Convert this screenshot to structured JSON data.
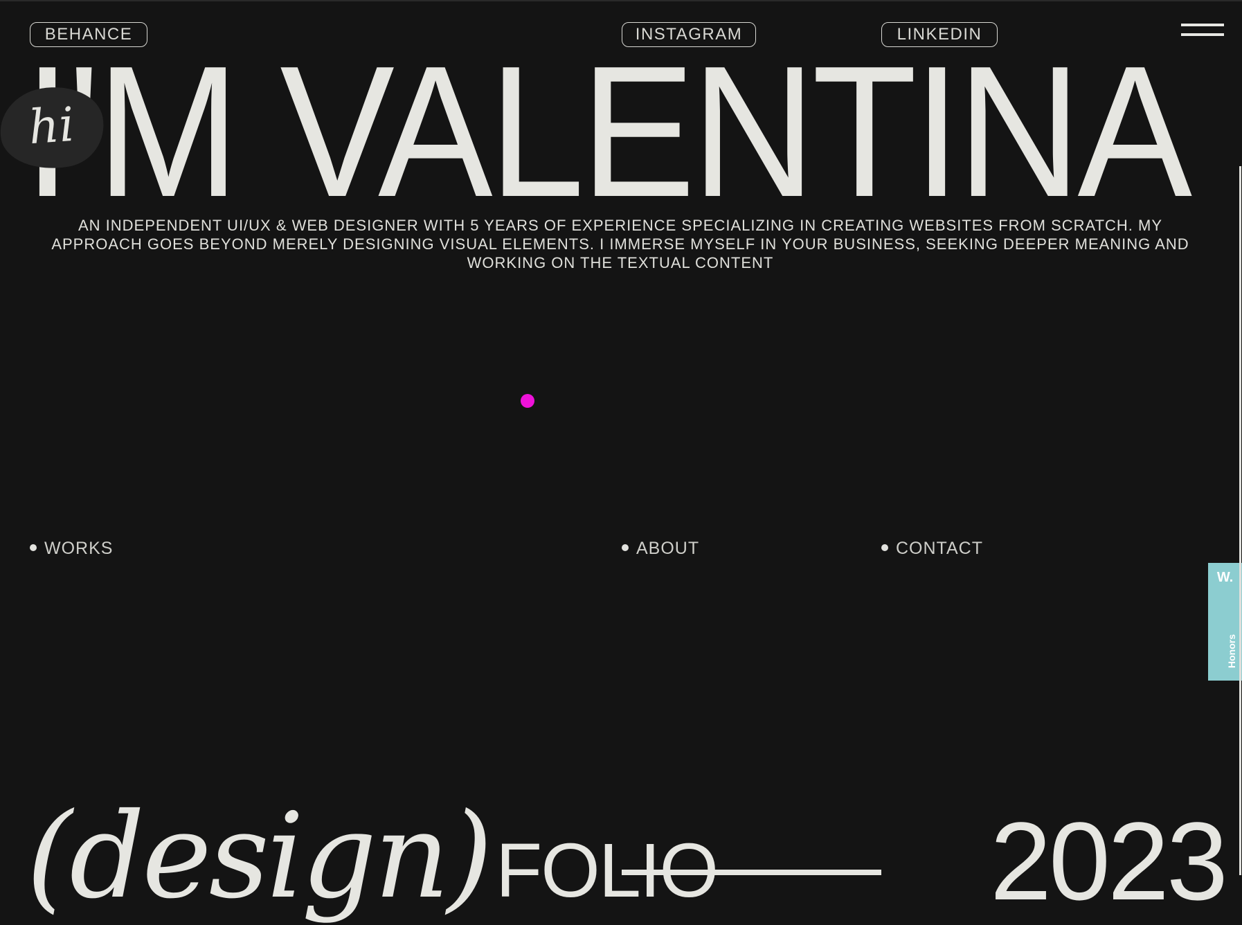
{
  "social_links": {
    "behance": "BEHANCE",
    "instagram": "INSTAGRAM",
    "linkedin": "LINKEDIN"
  },
  "hero": {
    "title": "I'M VALENTINA",
    "badge": "hi",
    "intro": "AN INDEPENDENT UI/UX & WEB DESIGNER WITH 5 YEARS OF EXPERIENCE SPECIALIZING IN CREATING WEBSITES FROM SCRATCH. MY APPROACH GOES BEYOND MERELY DESIGNING VISUAL ELEMENTS. I IMMERSE MYSELF IN YOUR BUSINESS, SEEKING DEEPER MEANING AND WORKING ON THE TEXTUAL CONTENT"
  },
  "nav": {
    "works": "WORKS",
    "about": "ABOUT",
    "contact": "CONTACT"
  },
  "honors_tab": {
    "mark": "W.",
    "label": "Honors"
  },
  "footer_preview": {
    "design": "(design)",
    "folio": "FOLIO",
    "year": "2023"
  },
  "colors": {
    "background": "#141414",
    "text": "#e6e6e1",
    "cursor_accent": "#ee12d9",
    "honors_tab": "#8ccdd0"
  },
  "icons": {
    "menu": "hamburger-menu-icon"
  }
}
